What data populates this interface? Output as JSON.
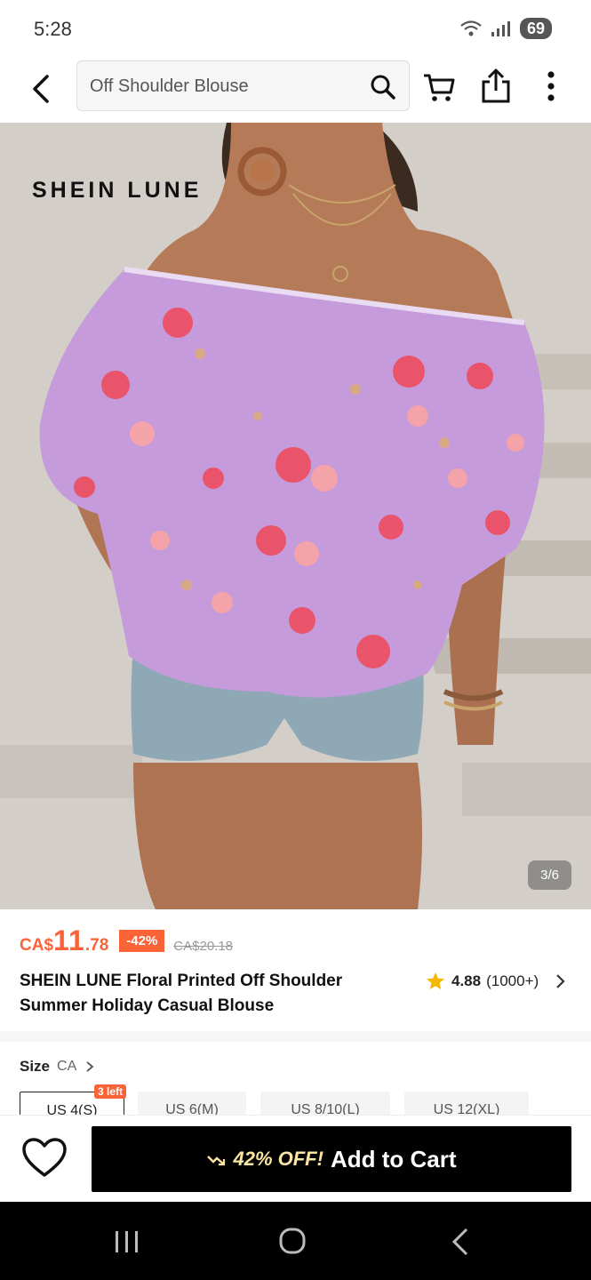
{
  "status_bar": {
    "time": "5:28",
    "battery": "69"
  },
  "search": {
    "value": "Off Shoulder Blouse"
  },
  "product": {
    "brand_watermark": "SHEIN LUNE",
    "image_counter": "3/6",
    "price": {
      "currency": "CA$",
      "integer": "11",
      "decimal": ".78",
      "discount": "-42%",
      "original": "CA$20.18"
    },
    "title": "SHEIN LUNE Floral Printed Off Shoulder Summer Holiday Casual Blouse",
    "rating": {
      "value": "4.88",
      "count": "(1000+)"
    }
  },
  "size": {
    "label": "Size",
    "region": "CA",
    "stock_badge": "3 left",
    "options": [
      "US 4(S)",
      "US 6(M)",
      "US 8/10(L)",
      "US 12(XL)"
    ]
  },
  "bottom": {
    "promo": "42% OFF!",
    "add_to_cart": "Add to Cart"
  },
  "colors": {
    "accent": "#fa6338",
    "blouse": "#c59bdc",
    "button": "#000000",
    "promo": "#fbe5a2",
    "star": "#f5b800"
  },
  "icons": [
    "back-arrow-icon",
    "search-icon",
    "cart-icon",
    "share-icon",
    "more-icon",
    "star-icon",
    "heart-icon",
    "trend-icon"
  ]
}
